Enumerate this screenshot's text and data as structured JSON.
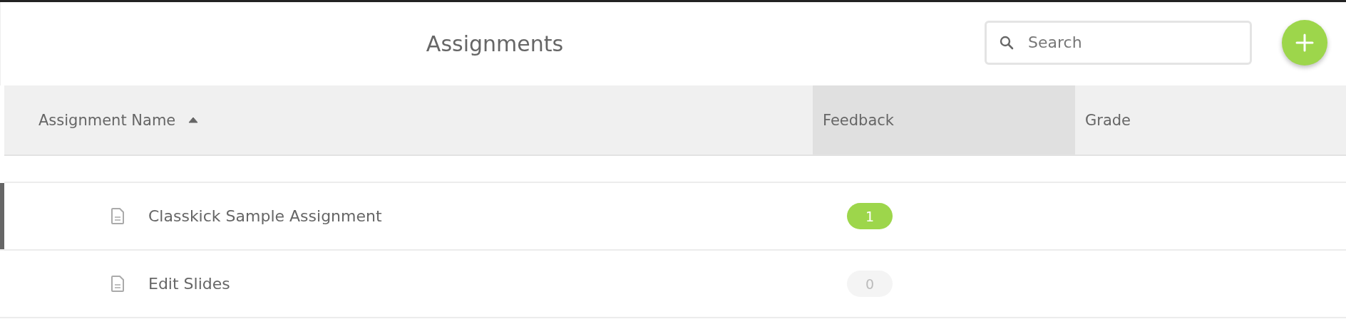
{
  "header": {
    "title": "Assignments",
    "search": {
      "placeholder": "Search"
    }
  },
  "table": {
    "columns": [
      {
        "label": "Assignment Name",
        "sorted": true,
        "highlighted": false
      },
      {
        "label": "Feedback",
        "sorted": false,
        "highlighted": true
      },
      {
        "label": "Grade",
        "sorted": false,
        "highlighted": false
      }
    ],
    "rows": [
      {
        "name": "Classkick Sample Assignment",
        "feedback": "1",
        "new_feedback": true,
        "selected": true
      },
      {
        "name": "Edit Slides",
        "feedback": "0",
        "new_feedback": false,
        "selected": false
      }
    ]
  }
}
